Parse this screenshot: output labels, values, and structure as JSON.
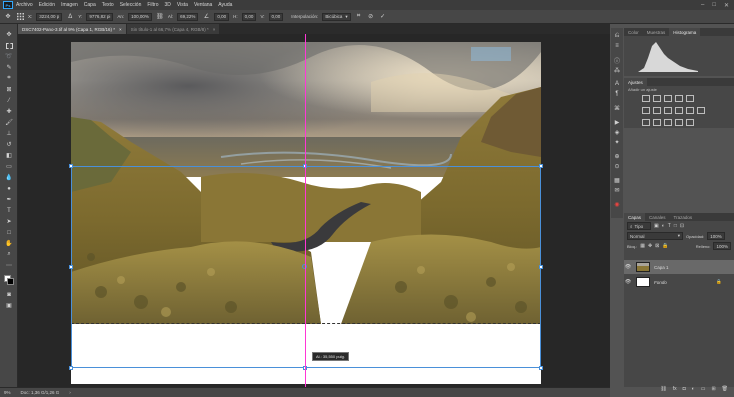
{
  "app": {
    "logo": "Ps",
    "menu": [
      "Archivo",
      "Edición",
      "Imagen",
      "Capa",
      "Texto",
      "Selección",
      "Filtro",
      "3D",
      "Vista",
      "Ventana",
      "Ayuda"
    ],
    "window_controls": [
      "–",
      "□",
      "✕"
    ]
  },
  "options_bar": {
    "x_label": "X:",
    "x_value": "3224,00 p",
    "y_label": "Y:",
    "y_value": "9776,82 pi",
    "w_label": "An:",
    "w_value": "100,00%",
    "h_label": "Al:",
    "h_value": "69,22%",
    "angle_value": "0,00",
    "h_skew_label": "H:",
    "h_skew_value": "0,00",
    "v_skew_label": "V:",
    "v_skew_value": "0,00",
    "interp_label": "Interpolación:",
    "interp_value": "Bicúbica",
    "cancel_icon": "⊘",
    "commit_icon": "✓"
  },
  "tabs": [
    {
      "label": "DSC7402-Pano-3.tif al 9% (Capa 1, RGB/16) *",
      "close": "×"
    },
    {
      "label": "Sin título-1 al 66,7% (Capa 4, RGB/8) *",
      "close": "×"
    }
  ],
  "canvas": {
    "tooltip": "Al.: 35,550 pulg."
  },
  "status": {
    "zoom": "9%",
    "doc_info": "Doc: 1,36 G/1,26 G",
    "arrow": "›"
  },
  "panels": {
    "histogram_tabs": [
      "Color",
      "Muestras",
      "Histograma"
    ],
    "histogram_active": "Histograma",
    "adjust_tabs": [
      "Ajustes"
    ],
    "adjust_hint": "Añadir un ajuste",
    "layers_tabs": [
      "Capas",
      "Canales",
      "Trazados"
    ],
    "layers_active": "Capas",
    "filter_placeholder": "Tipo",
    "blend_mode": "Normal",
    "opacity_label": "Opacidad:",
    "opacity_value": "100%",
    "lock_label": "Bloq.:",
    "fill_label": "Relleno:",
    "fill_value": "100%",
    "layers": [
      {
        "name": "Capa 1",
        "selected": true,
        "visible": true
      },
      {
        "name": "Fondo",
        "selected": false,
        "visible": true,
        "locked": true
      }
    ]
  },
  "colors": {
    "accent": "#31a8ff",
    "guide": "#ff36d6",
    "transform_box": "#4a90d9"
  }
}
